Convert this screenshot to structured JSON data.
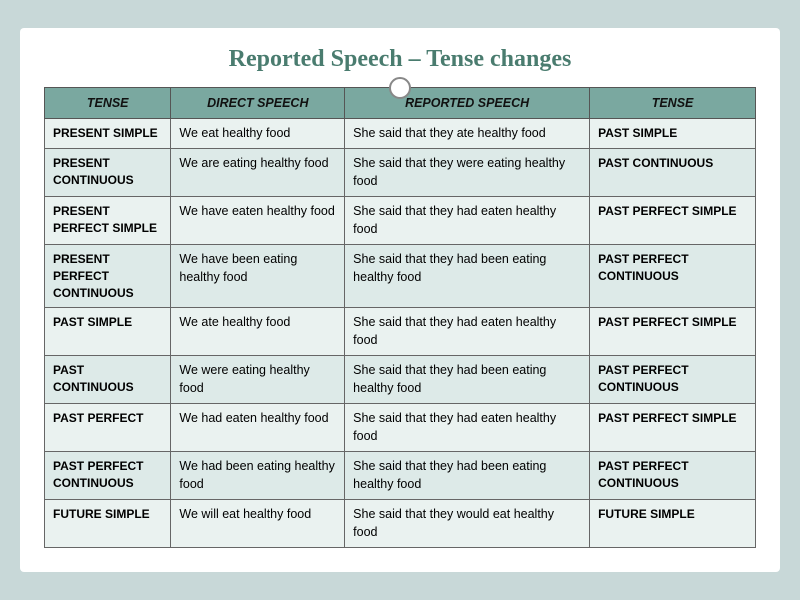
{
  "title": "Reported Speech – Tense changes",
  "header": {
    "col1": "TENSE",
    "col2": "DIRECT SPEECH",
    "col3": "REPORTED SPEECH",
    "col4": "TENSE"
  },
  "rows": [
    {
      "tense": "PRESENT SIMPLE",
      "direct": "We eat healthy food",
      "reported": "She said that they ate healthy food",
      "tense2": "PAST SIMPLE"
    },
    {
      "tense": "PRESENT CONTINUOUS",
      "direct": "We are eating healthy food",
      "reported": "She said that they were eating healthy food",
      "tense2": "PAST CONTINUOUS"
    },
    {
      "tense": "PRESENT PERFECT SIMPLE",
      "direct": "We have eaten healthy food",
      "reported": "She said that they had eaten healthy food",
      "tense2": "PAST PERFECT SIMPLE"
    },
    {
      "tense": "PRESENT PERFECT CONTINUOUS",
      "direct": "We have been eating healthy food",
      "reported": "She said that they had been eating  healthy food",
      "tense2": "PAST PERFECT CONTINUOUS"
    },
    {
      "tense": "PAST SIMPLE",
      "direct": "We ate healthy food",
      "reported": "She said that they had eaten healthy food",
      "tense2": "PAST PERFECT SIMPLE"
    },
    {
      "tense": "PAST CONTINUOUS",
      "direct": "We were eating healthy food",
      "reported": "She said that they had been eating healthy food",
      "tense2": "PAST PERFECT CONTINUOUS"
    },
    {
      "tense": "PAST PERFECT",
      "direct": "We had eaten healthy food",
      "reported": "She said that they had eaten healthy food",
      "tense2": "PAST PERFECT SIMPLE"
    },
    {
      "tense": "PAST PERFECT CONTINUOUS",
      "direct": "We had been eating healthy food",
      "reported": "She said that they had been eating  healthy food",
      "tense2": "PAST PERFECT CONTINUOUS"
    },
    {
      "tense": "FUTURE SIMPLE",
      "direct": "We will eat healthy food",
      "reported": "She said that they would eat healthy food",
      "tense2": "FUTURE SIMPLE"
    }
  ]
}
